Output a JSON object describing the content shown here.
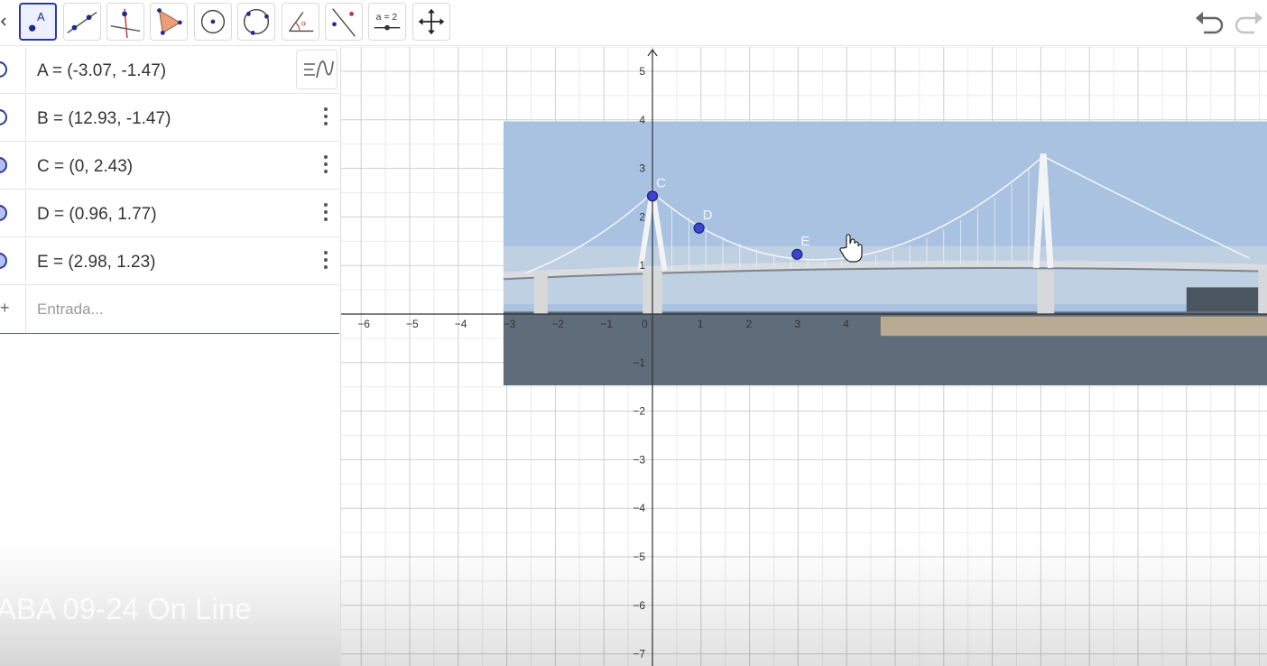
{
  "toolbar": {
    "tools": [
      {
        "id": "point",
        "icon": "point-tool-icon",
        "label": "A",
        "active": true
      },
      {
        "id": "line",
        "icon": "line-tool-icon"
      },
      {
        "id": "perpendicular",
        "icon": "perpendicular-line-tool-icon"
      },
      {
        "id": "polygon",
        "icon": "polygon-tool-icon"
      },
      {
        "id": "circle-center",
        "icon": "circle-center-point-tool-icon"
      },
      {
        "id": "circle-three-points",
        "icon": "circle-three-points-tool-icon"
      },
      {
        "id": "angle",
        "icon": "angle-tool-icon"
      },
      {
        "id": "reflect",
        "icon": "reflect-line-tool-icon"
      },
      {
        "id": "slider",
        "icon": "slider-tool-icon",
        "label": "a = 2"
      },
      {
        "id": "move-view",
        "icon": "move-graphics-view-icon"
      }
    ],
    "undo_icon": "undo-icon",
    "redo_icon": "redo-icon"
  },
  "algebra": {
    "rows": [
      {
        "name": "A",
        "value": "A = (-3.07, -1.47)",
        "visible": false
      },
      {
        "name": "B",
        "value": "B = (12.93, -1.47)",
        "visible": false
      },
      {
        "name": "C",
        "value": "C = (0, 2.43)",
        "visible": true
      },
      {
        "name": "D",
        "value": "D = (0.96, 1.77)",
        "visible": true
      },
      {
        "name": "E",
        "value": "E = (2.98, 1.23)",
        "visible": true
      }
    ],
    "input_placeholder": "Entrada...",
    "input_prefix": "+",
    "style_icon": "algebra-style-icon"
  },
  "watermark": "ABA 09-24 On Line",
  "graphics": {
    "x_ticks": [
      "−6",
      "−5",
      "−4",
      "−3",
      "−2",
      "−1",
      "0",
      "1",
      "2",
      "3",
      "4"
    ],
    "y_ticks": [
      "5",
      "4",
      "3",
      "2",
      "1",
      "−1",
      "−2",
      "−3",
      "−4",
      "−5",
      "−6",
      "−7"
    ],
    "points": [
      {
        "name": "C",
        "x": 0,
        "y": 2.43
      },
      {
        "name": "D",
        "x": 0.96,
        "y": 1.77
      },
      {
        "name": "E",
        "x": 2.98,
        "y": 1.23
      }
    ],
    "image_corner_A": [
      -3.07,
      -1.47
    ],
    "image_corner_B": [
      12.93,
      -1.47
    ],
    "image_top_y": 3.97,
    "point_color": "#3a45d0",
    "sky_color": "#a9c2e2",
    "water_color": "#5f6d7a"
  }
}
